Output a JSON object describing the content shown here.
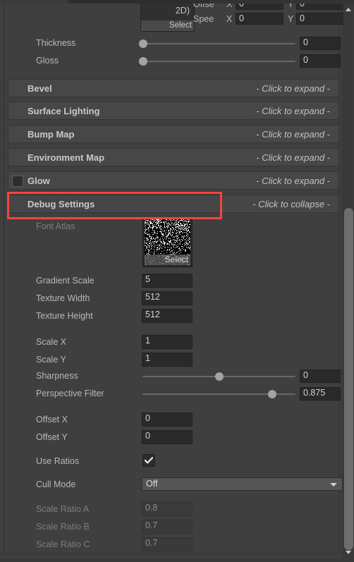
{
  "window": {
    "scroll_up_icon": "triangle-up-icon",
    "scroll_down_icon": "triangle-down-icon"
  },
  "clipped_top": {
    "object_field": {
      "label": "2D)",
      "select_label": "Select"
    },
    "rows": [
      {
        "name": "Offse",
        "x_label": "X",
        "x_value": "0",
        "y_label": "Y",
        "y_value": "0"
      },
      {
        "name": "Spee",
        "x_label": "X",
        "x_value": "0",
        "y_label": "Y",
        "y_value": "0"
      }
    ]
  },
  "sliders_top": [
    {
      "label": "Thickness",
      "value": "0",
      "fill": 0
    },
    {
      "label": "Gloss",
      "value": "0",
      "fill": 0
    }
  ],
  "foldouts": [
    {
      "label": "Bevel",
      "hint": "- Click to expand -",
      "checkbox": false,
      "has_checkbox": false,
      "expanded": false
    },
    {
      "label": "Surface Lighting",
      "hint": "- Click to expand -",
      "checkbox": false,
      "has_checkbox": false,
      "expanded": false
    },
    {
      "label": "Bump Map",
      "hint": "- Click to expand -",
      "checkbox": false,
      "has_checkbox": false,
      "expanded": false
    },
    {
      "label": "Environment Map",
      "hint": "- Click to expand -",
      "checkbox": false,
      "has_checkbox": false,
      "expanded": false
    },
    {
      "label": "Glow",
      "hint": "- Click to expand -",
      "checkbox": false,
      "has_checkbox": true,
      "expanded": false
    },
    {
      "label": "Debug Settings",
      "hint": "- Click to collapse -",
      "checkbox": false,
      "has_checkbox": false,
      "expanded": true
    }
  ],
  "highlight": {
    "color": "#f4453c",
    "target": "Debug Settings"
  },
  "debug_settings": {
    "font_atlas": {
      "label": "Font Atlas",
      "select_label": "Select",
      "preview": "font-atlas-texture"
    },
    "fields": [
      {
        "label": "Gradient Scale",
        "value": "5",
        "disabled": false
      },
      {
        "label": "Texture Width",
        "value": "512",
        "disabled": false
      },
      {
        "label": "Texture Height",
        "value": "512",
        "disabled": false
      },
      {
        "label": "Scale X",
        "value": "1",
        "disabled": false
      },
      {
        "label": "Scale Y",
        "value": "1",
        "disabled": false
      }
    ],
    "sliders": [
      {
        "label": "Sharpness",
        "value": "0",
        "fill": 50
      },
      {
        "label": "Perspective Filter",
        "value": "0.875",
        "fill": 85
      }
    ],
    "offsets": [
      {
        "label": "Offset X",
        "value": "0",
        "disabled": false
      },
      {
        "label": "Offset Y",
        "value": "0",
        "disabled": false
      }
    ],
    "use_ratios": {
      "label": "Use Ratios",
      "checked": true,
      "check_icon": "checkmark-icon"
    },
    "cull_mode": {
      "label": "Cull Mode",
      "value": "Off",
      "arrow_icon": "chevron-down-icon"
    },
    "ratios": [
      {
        "label": "Scale Ratio A",
        "value": "0.8",
        "disabled": true
      },
      {
        "label": "Scale Ratio B",
        "value": "0.7",
        "disabled": true
      },
      {
        "label": "Scale Ratio C",
        "value": "0.7",
        "disabled": true
      }
    ]
  }
}
